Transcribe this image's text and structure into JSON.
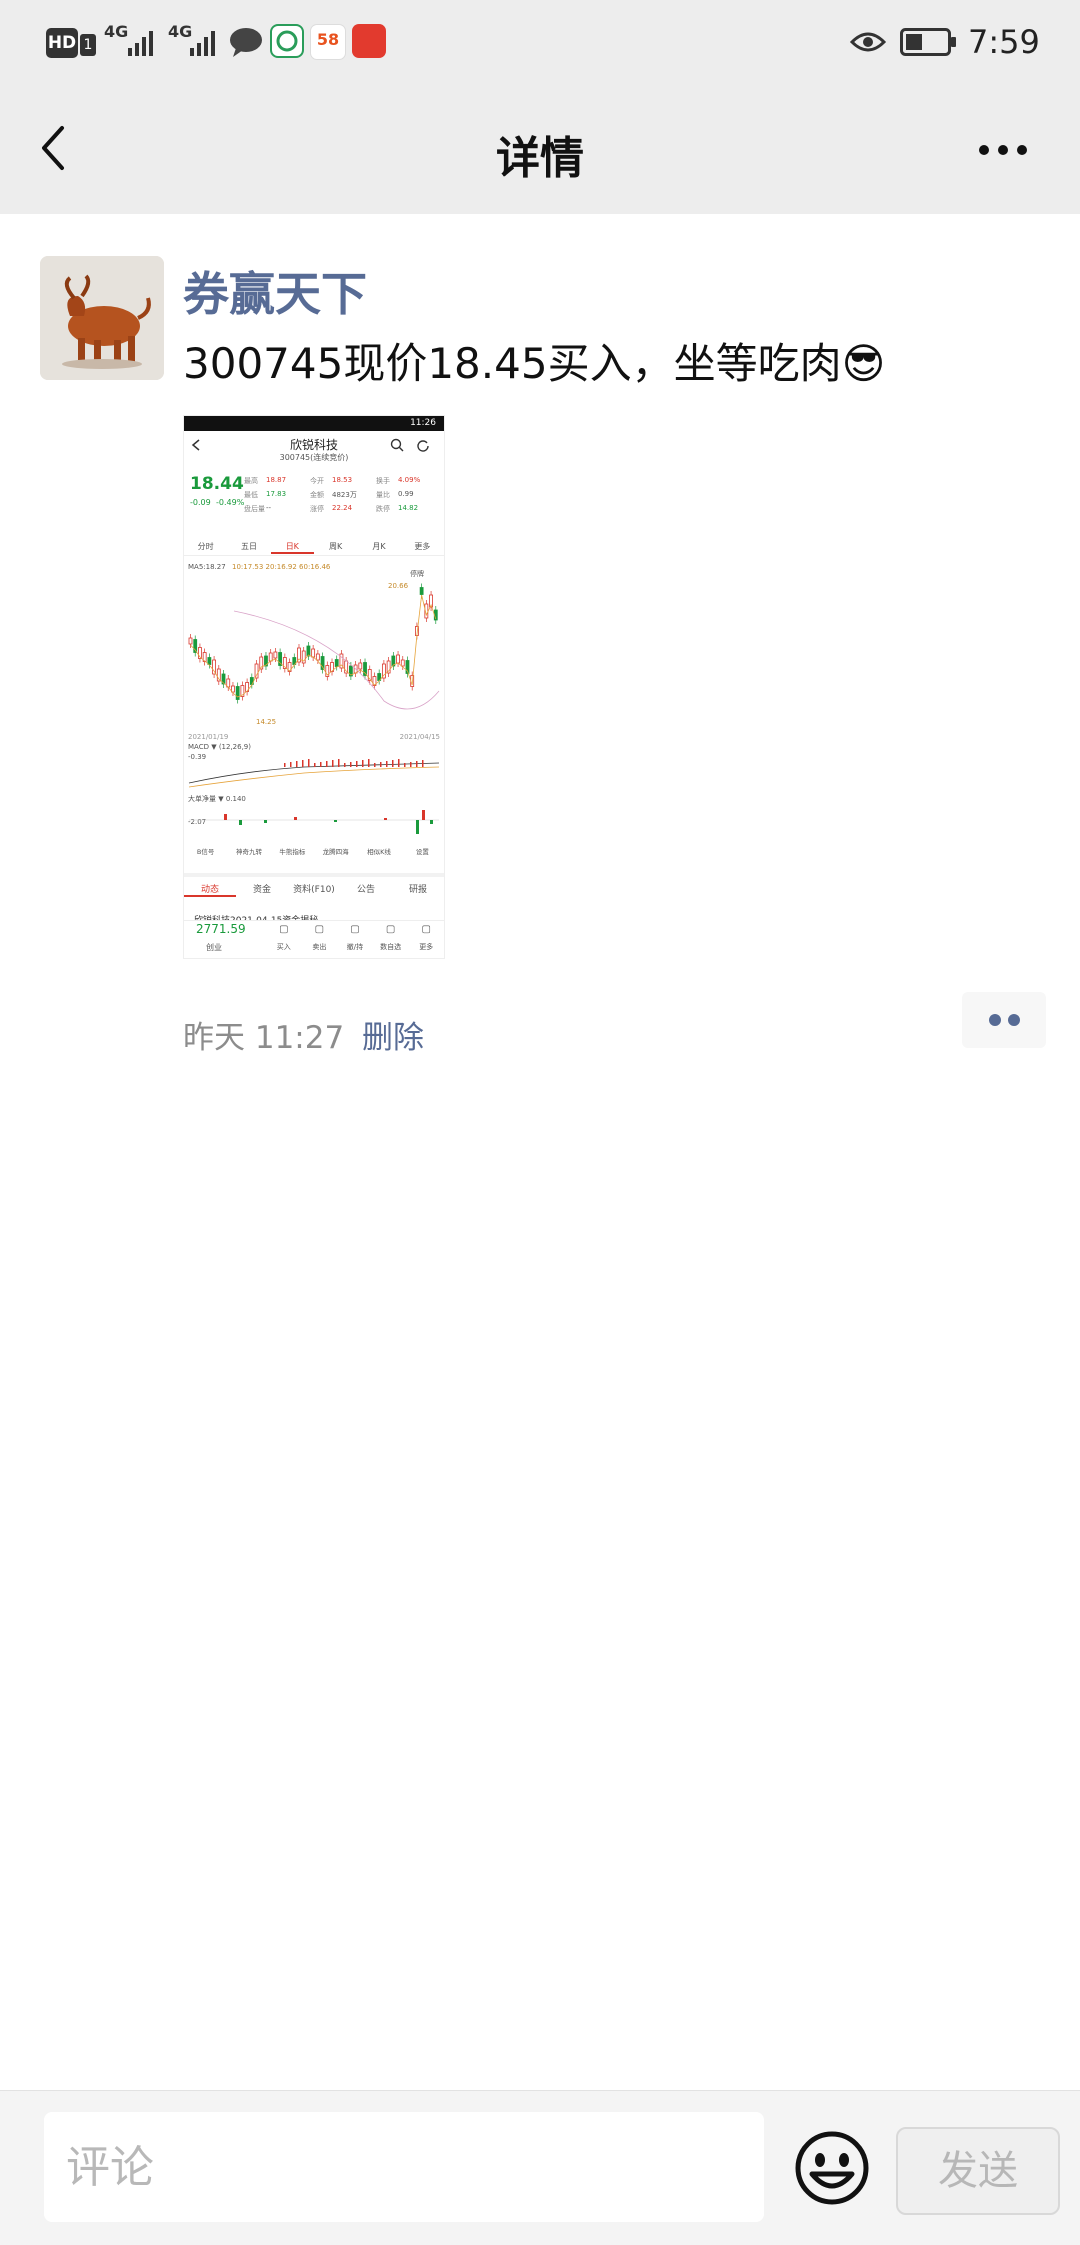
{
  "status_bar": {
    "hd_badge": "HD",
    "sim_index": "1",
    "network_1": "4G",
    "network_2": "4G",
    "app_badge_58": "58",
    "time": "7:59"
  },
  "nav": {
    "title": "详情"
  },
  "post": {
    "author": "券赢天下",
    "content": "300745现价18.45买入，坐等吃肉",
    "content_emoji": "😎",
    "time": "昨天 11:27",
    "delete_label": "删除"
  },
  "screenshot": {
    "status_time": "11:26",
    "stock_name": "欣锐科技",
    "stock_sub": "300745(连续竞价)",
    "price": "18.44",
    "change": "-0.09",
    "change_pct": "-0.49%",
    "stats": [
      {
        "label": "最高",
        "value": "18.87"
      },
      {
        "label": "今开",
        "value": "18.53"
      },
      {
        "label": "换手",
        "value": "4.09%"
      },
      {
        "label": "最低",
        "value": "17.83"
      },
      {
        "label": "金额",
        "value": "4823万"
      },
      {
        "label": "量比",
        "value": "0.99"
      },
      {
        "label": "盘后量",
        "value": "--"
      },
      {
        "label": "涨停",
        "value": "22.24"
      },
      {
        "label": "跌停",
        "value": "14.82"
      }
    ],
    "tabs": [
      "分时",
      "五日",
      "日K",
      "周K",
      "月K",
      "更多"
    ],
    "active_tab": "日K",
    "ma_label": "MA5:18.27",
    "ma_others": "10:17.53  20:16.92  60:16.46",
    "high_marker": "20.66",
    "low_marker": "14.25",
    "resume_label": "停牌",
    "date_start": "2021/01/19",
    "date_end": "2021/04/15",
    "macd_label": "MACD ▼ (12,26,9)",
    "macd_value": "-0.39",
    "fund_label": "大单净量 ▼ 0.140",
    "fund_value": "-2.07",
    "signal_tools": [
      "B信号",
      "神奇九转",
      "牛熊指标",
      "龙腾四海",
      "相似K线",
      "设置"
    ],
    "bottom_tabs": [
      "动态",
      "资金",
      "资料(F10)",
      "公告",
      "研报"
    ],
    "news_line": "欣锐科技2021-04-15资金揭秘",
    "index_value": "2771.59",
    "index_name": "创业",
    "actions": [
      "买入",
      "卖出",
      "撤/持",
      "数自选",
      "更多"
    ]
  },
  "comment_bar": {
    "placeholder": "评论",
    "send_label": "发送"
  }
}
